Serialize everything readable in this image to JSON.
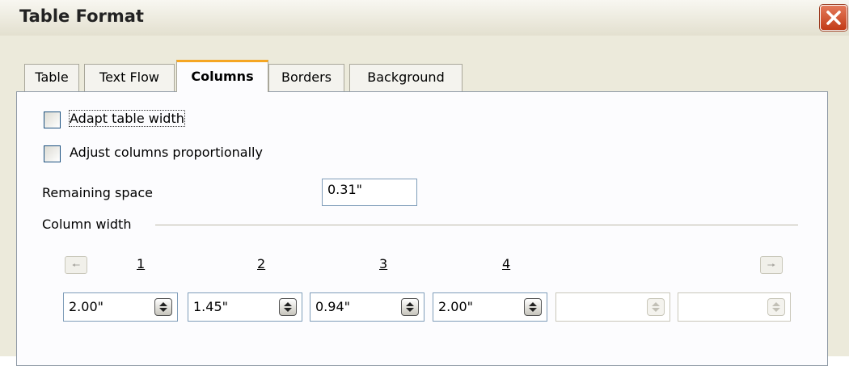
{
  "window": {
    "title": "Table Format"
  },
  "tabs": [
    {
      "label": "Table",
      "active": false
    },
    {
      "label": "Text Flow",
      "active": false
    },
    {
      "label": "Columns",
      "active": true
    },
    {
      "label": "Borders",
      "active": false
    },
    {
      "label": "Background",
      "active": false
    }
  ],
  "options": {
    "adapt_table_width": {
      "label": "Adapt table width",
      "checked": false
    },
    "adjust_proportionally": {
      "label": "Adjust columns proportionally",
      "checked": false
    }
  },
  "remaining_space": {
    "label": "Remaining space",
    "value": "0.31\""
  },
  "column_width": {
    "section_label": "Column width",
    "column_numbers": [
      "1",
      "2",
      "3",
      "4"
    ],
    "widths": [
      "2.00\"",
      "1.45\"",
      "0.94\"",
      "2.00\"",
      "",
      ""
    ],
    "left_arrow_icon": "arrow-left-icon",
    "right_arrow_icon": "arrow-right-icon"
  }
}
